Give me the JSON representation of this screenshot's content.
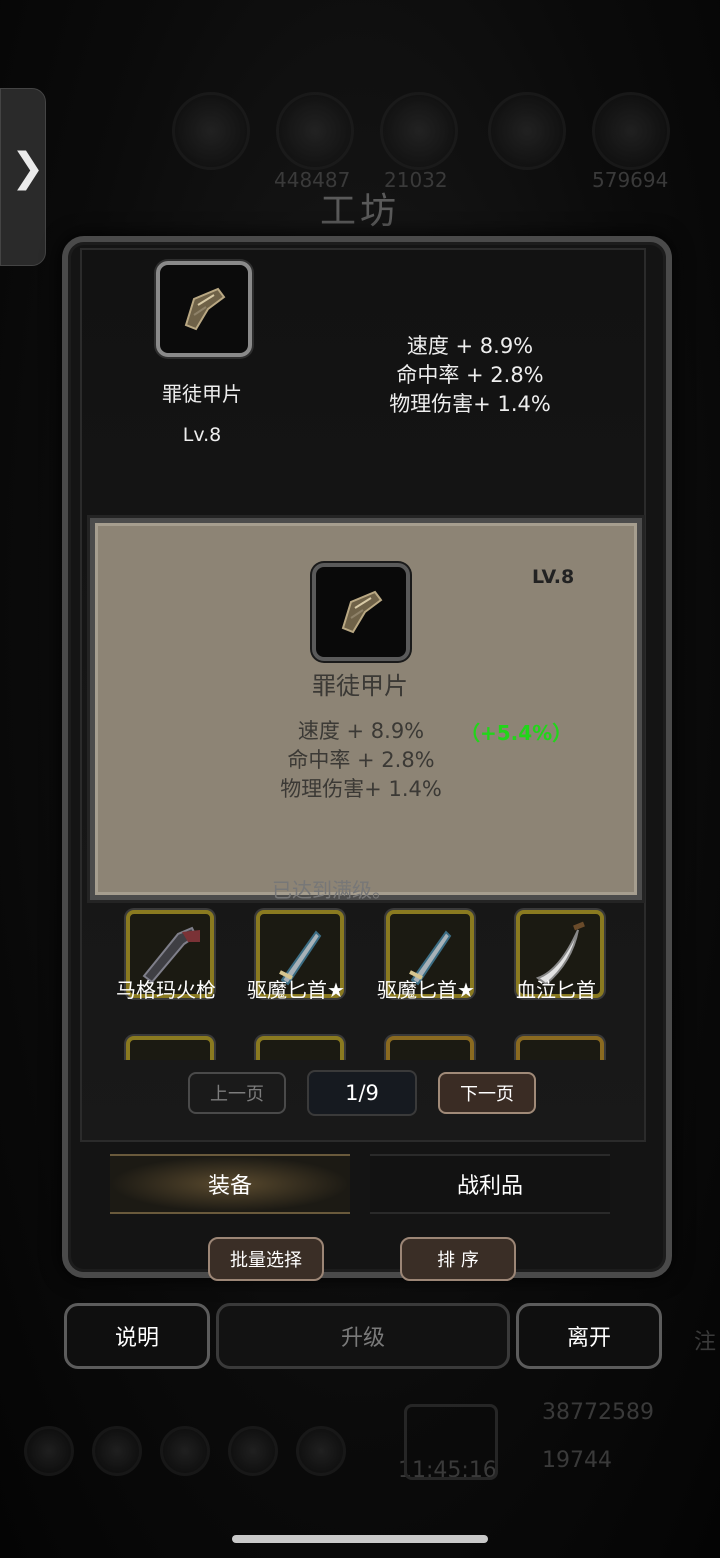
{
  "header": {
    "title": "工坊",
    "bg_values": [
      "448487",
      "21032",
      "579694"
    ]
  },
  "current_item": {
    "name": "罪徒甲片",
    "level": "Lv.8",
    "stats": [
      "速度 + 8.9%",
      "命中率 + 2.8%",
      "物理伤害+ 1.4%"
    ]
  },
  "popup": {
    "level": "LV.8",
    "name": "罪徒甲片",
    "stats": [
      "速度 + 8.9%",
      "命中率 + 2.8%",
      "物理伤害+ 1.4%"
    ],
    "bonus": "（+5.4%）",
    "bonus_color": "#22d51a",
    "partial_text": "已达到满级。"
  },
  "items": [
    {
      "name": "马格玛火枪",
      "icon": "musket-icon"
    },
    {
      "name": "驱魔匕首★",
      "icon": "dagger-icon"
    },
    {
      "name": "驱魔匕首★",
      "icon": "dagger-icon"
    },
    {
      "name": "血泣匕首",
      "icon": "curved-knife-icon"
    }
  ],
  "pager": {
    "prev": "上一页",
    "page": "1/9",
    "next": "下一页"
  },
  "tabs": {
    "equipment": "装备",
    "loot": "战利品"
  },
  "actions": {
    "batch_select": "批量选择",
    "sort": "排 序",
    "explain": "说明",
    "upgrade": "升级",
    "leave": "离开"
  },
  "background": {
    "gold": "38772589",
    "gems": "19744",
    "time": "11:45:16",
    "side_char": "注"
  }
}
